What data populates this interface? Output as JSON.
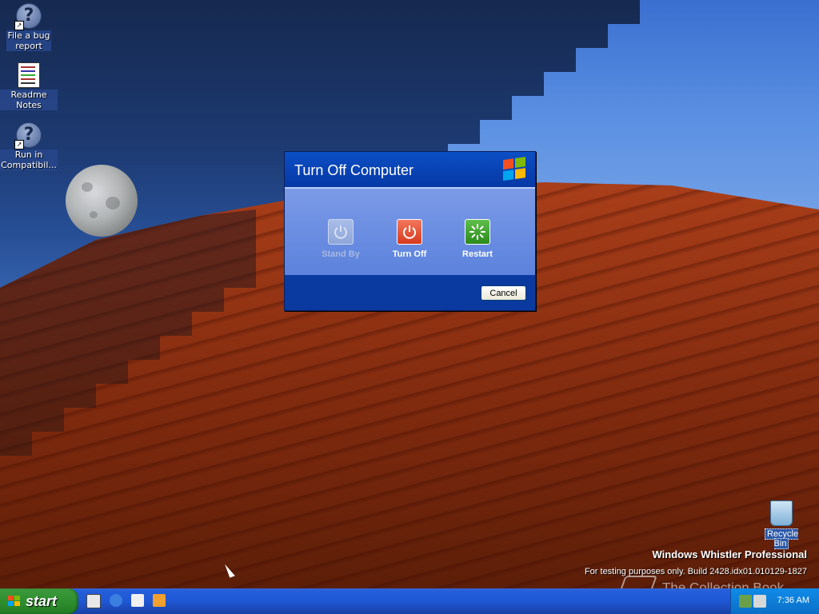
{
  "desktop": {
    "icons": [
      {
        "label_line1": "File a bug",
        "label_line2": "report",
        "icon": "help-shortcut-icon"
      },
      {
        "label_line1": "Readme Notes",
        "label_line2": "",
        "icon": "readme-notes-icon"
      },
      {
        "label_line1": "Run in",
        "label_line2": "Compatibil...",
        "icon": "help-shortcut-icon"
      }
    ],
    "recycle_bin": {
      "label": "Recycle Bin",
      "icon": "recycle-bin-icon"
    }
  },
  "dialog": {
    "title": "Turn Off Computer",
    "options": [
      {
        "label": "Stand By",
        "icon": "standby-power-icon",
        "enabled": false
      },
      {
        "label": "Turn Off",
        "icon": "power-icon",
        "enabled": true
      },
      {
        "label": "Restart",
        "icon": "restart-icon",
        "enabled": true
      }
    ],
    "cancel_label": "Cancel"
  },
  "branding": {
    "title": "Windows Whistler Professional",
    "build": "For testing purposes only. Build 2428.idx01.010129-1827",
    "watermark": "The Collection Book"
  },
  "taskbar": {
    "start_label": "start",
    "quick_launch": [
      "show-desktop-icon",
      "internet-explorer-icon",
      "outlook-express-icon",
      "media-player-icon"
    ],
    "clock": "7:36 AM"
  },
  "colors": {
    "taskbar_blue": "#245edb",
    "start_green": "#2f8f2f",
    "dialog_blue": "#5a7edc",
    "turnoff_red": "#d63b1f",
    "restart_green": "#2c8a1c"
  }
}
